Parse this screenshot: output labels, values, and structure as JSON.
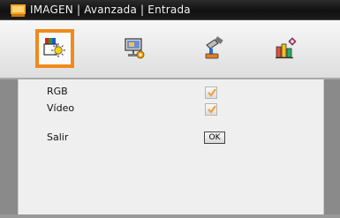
{
  "window": {
    "title": "IMAGEN | Avanzada | Entrada",
    "title_icon": "projector-menu-icon"
  },
  "tabs": [
    {
      "icon": "image-settings-icon",
      "active": true
    },
    {
      "icon": "display-settings-icon",
      "active": false
    },
    {
      "icon": "setup-tools-icon",
      "active": false
    },
    {
      "icon": "options-icon",
      "active": false
    }
  ],
  "menu": {
    "rows": [
      {
        "label": "RGB",
        "control": "checkbox",
        "checked": true
      },
      {
        "label": "Vídeo",
        "control": "checkbox",
        "checked": true
      },
      {
        "label": "Salir",
        "control": "button",
        "button_label": "OK"
      }
    ]
  },
  "colors": {
    "title_bar": "#111111",
    "active_tab_border": "#f08a1b",
    "check_mark": "#f0a040"
  }
}
